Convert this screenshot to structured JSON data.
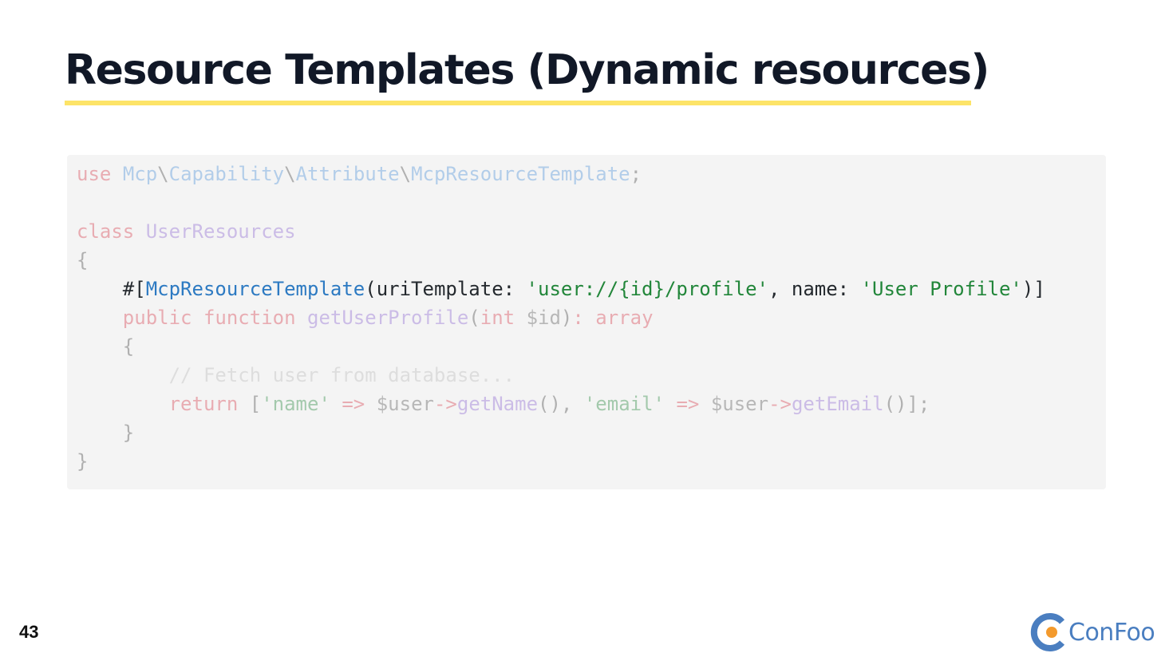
{
  "slide": {
    "title": "Resource Templates (Dynamic resources)",
    "page_number": "43",
    "logo_text": "ConFoo"
  },
  "colors": {
    "title_underline": "#fde468",
    "code_background": "#f4f4f4",
    "logo_blue": "#4a7ec0",
    "logo_orange": "#f39a2d"
  },
  "code": {
    "language": "php",
    "highlighted_line": 4,
    "lines": [
      "use Mcp\\Capability\\Attribute\\McpResourceTemplate;",
      "",
      "class UserResources",
      "{",
      "    #[McpResourceTemplate(uriTemplate: 'user://{id}/profile', name: 'User Profile')]",
      "    public function getUserProfile(int $id): array",
      "    {",
      "        // Fetch user from database...",
      "        return ['name' => $user->getName(), 'email' => $user->getEmail()];",
      "    }",
      "}"
    ]
  },
  "icons": {
    "logo": "confoo-logo-icon"
  }
}
